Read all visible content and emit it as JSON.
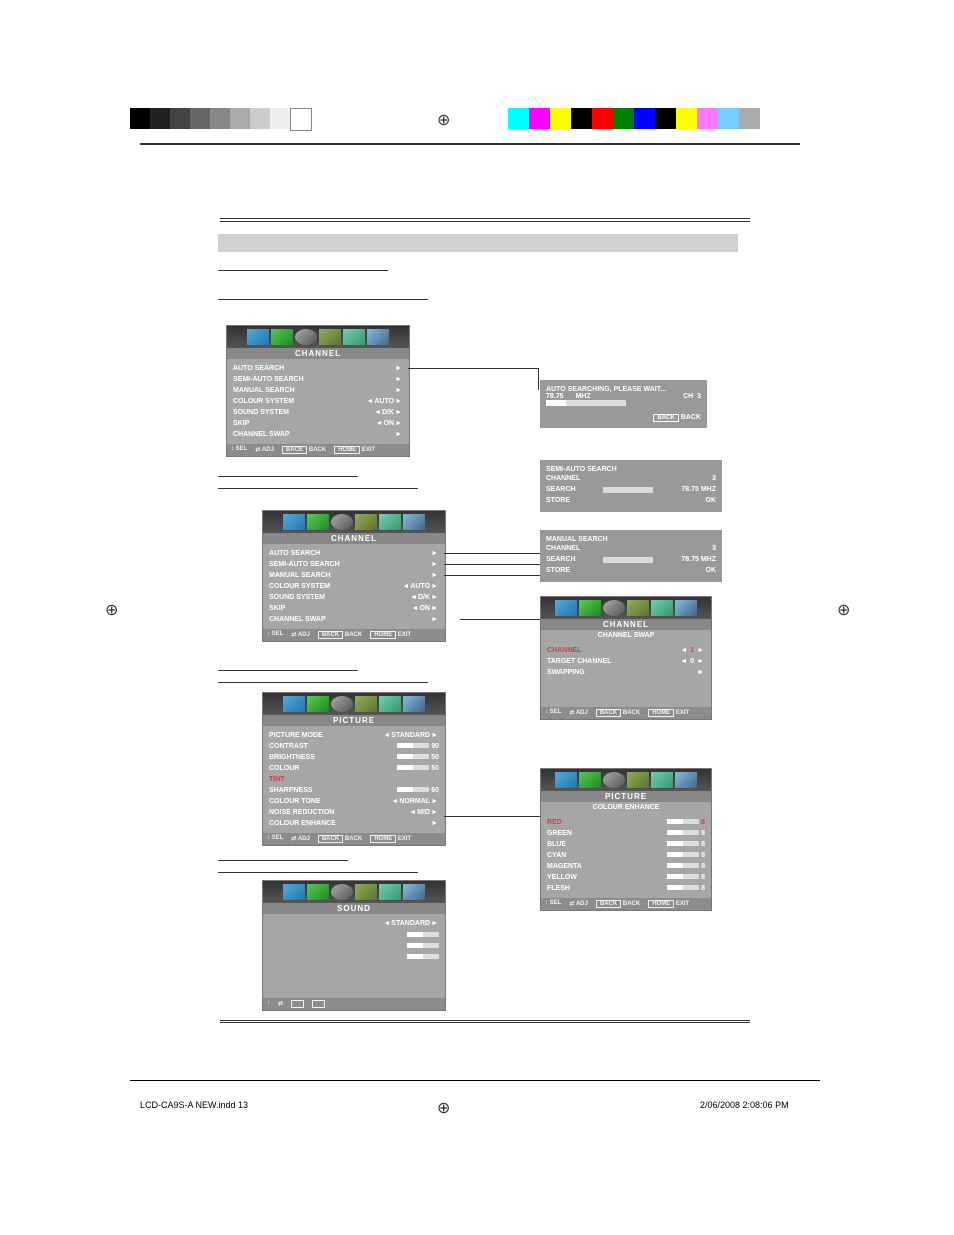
{
  "footer": {
    "file": "LCD-CA9S-A NEW.indd   13",
    "date": "2/06/2008   2:08:06 PM"
  },
  "osd_channel": {
    "title": "CHANNEL",
    "items": [
      {
        "label": "AUTO SEARCH",
        "val": ""
      },
      {
        "label": "SEMI-AUTO SEARCH",
        "val": ""
      },
      {
        "label": "MANUAL SEARCH",
        "val": ""
      },
      {
        "label": "COLOUR SYSTEM",
        "val": "AUTO"
      },
      {
        "label": "SOUND SYSTEM",
        "val": "D/K"
      },
      {
        "label": "SKIP",
        "val": "ON"
      },
      {
        "label": "CHANNEL SWAP",
        "val": ""
      }
    ],
    "footer": {
      "sel": "SEL",
      "adj": "ADJ",
      "back": "BACK",
      "exit": "EXIT",
      "back_btn": "BACK",
      "exit_btn": "HOME"
    }
  },
  "auto_popup": {
    "title": "AUTO SEARCHING, PLEASE WAIT...",
    "freq": "78.75",
    "unit": "MHZ",
    "ch_label": "CH",
    "ch": "3",
    "back": "BACK",
    "back_btn": "BACK"
  },
  "semi_popup": {
    "title": "SEMI-AUTO SEARCH",
    "rows": [
      {
        "l": "CHANNEL",
        "v": "3"
      },
      {
        "l": "SEARCH",
        "v": "78.75 MHZ"
      },
      {
        "l": "STORE",
        "v": "OK"
      }
    ]
  },
  "manual_popup": {
    "title": "MANUAL SEARCH",
    "rows": [
      {
        "l": "CHANNEL",
        "v": "3"
      },
      {
        "l": "SEARCH",
        "v": "78.75 MHZ"
      },
      {
        "l": "STORE",
        "v": "OK"
      }
    ]
  },
  "swap": {
    "title": "CHANNEL",
    "sub": "CHANNEL SWAP",
    "rows": [
      {
        "l": "CHANNEL",
        "v": "1"
      },
      {
        "l": "TARGET CHANNEL",
        "v": "0"
      },
      {
        "l": "SWAPPING",
        "v": ""
      }
    ]
  },
  "picture": {
    "title": "PICTURE",
    "rows": [
      {
        "l": "PICTURE MODE",
        "v": "STANDARD",
        "arrows": true
      },
      {
        "l": "CONTRAST",
        "v": "90",
        "slider": true
      },
      {
        "l": "BRIGHTNESS",
        "v": "50",
        "slider": true
      },
      {
        "l": "COLOUR",
        "v": "50",
        "slider": true
      },
      {
        "l": "TINT",
        "v": "",
        "slider": false,
        "dim": true
      },
      {
        "l": "SHARPNESS",
        "v": "60",
        "slider": true
      },
      {
        "l": "COLOUR TONE",
        "v": "NORMAL",
        "arrows": true
      },
      {
        "l": "NOISE   REDUCTION",
        "v": "MID",
        "arrows": true
      },
      {
        "l": "COLOUR ENHANCE",
        "v": ""
      }
    ]
  },
  "enhance": {
    "title": "PICTURE",
    "sub": "COLOUR ENHANCE",
    "rows": [
      {
        "l": "RED",
        "v": "8"
      },
      {
        "l": "GREEN",
        "v": "8"
      },
      {
        "l": "BLUE",
        "v": "8"
      },
      {
        "l": "CYAN",
        "v": "8"
      },
      {
        "l": "MAGENTA",
        "v": "8"
      },
      {
        "l": "YELLOW",
        "v": "8"
      },
      {
        "l": "FLESH",
        "v": "8"
      }
    ]
  },
  "sound": {
    "title": "SOUND",
    "rows": [
      {
        "l": "",
        "v": "STANDARD",
        "arrows": true
      }
    ],
    "sliders": 3
  }
}
